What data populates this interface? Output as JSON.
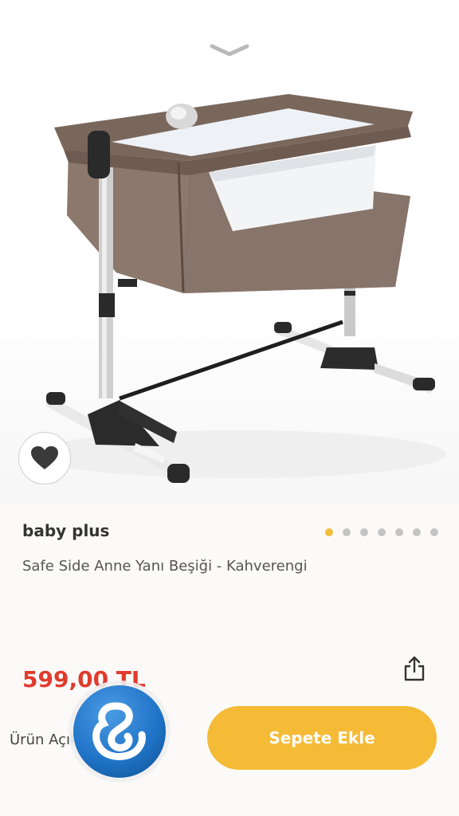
{
  "product": {
    "brand": "baby plus",
    "name": "Safe Side Anne Yanı Beşiği - Kahverengi",
    "price": "599,00 TL"
  },
  "gallery": {
    "total_images": 7,
    "active_index": 0
  },
  "actions": {
    "add_to_cart_label": "Sepete Ekle",
    "details_link_label": "Ürün Açıklaması"
  },
  "icons": {
    "collapse": "chevron-down-icon",
    "favorite": "heart-icon",
    "share": "share-icon",
    "floating_app": "app-logo-icon"
  },
  "colors": {
    "accent": "#f5bb37",
    "price": "#e03b2d",
    "dot_active": "#f2be3a",
    "dot_inactive": "#c4c4c4",
    "logo_blue": "#1f73c6"
  }
}
